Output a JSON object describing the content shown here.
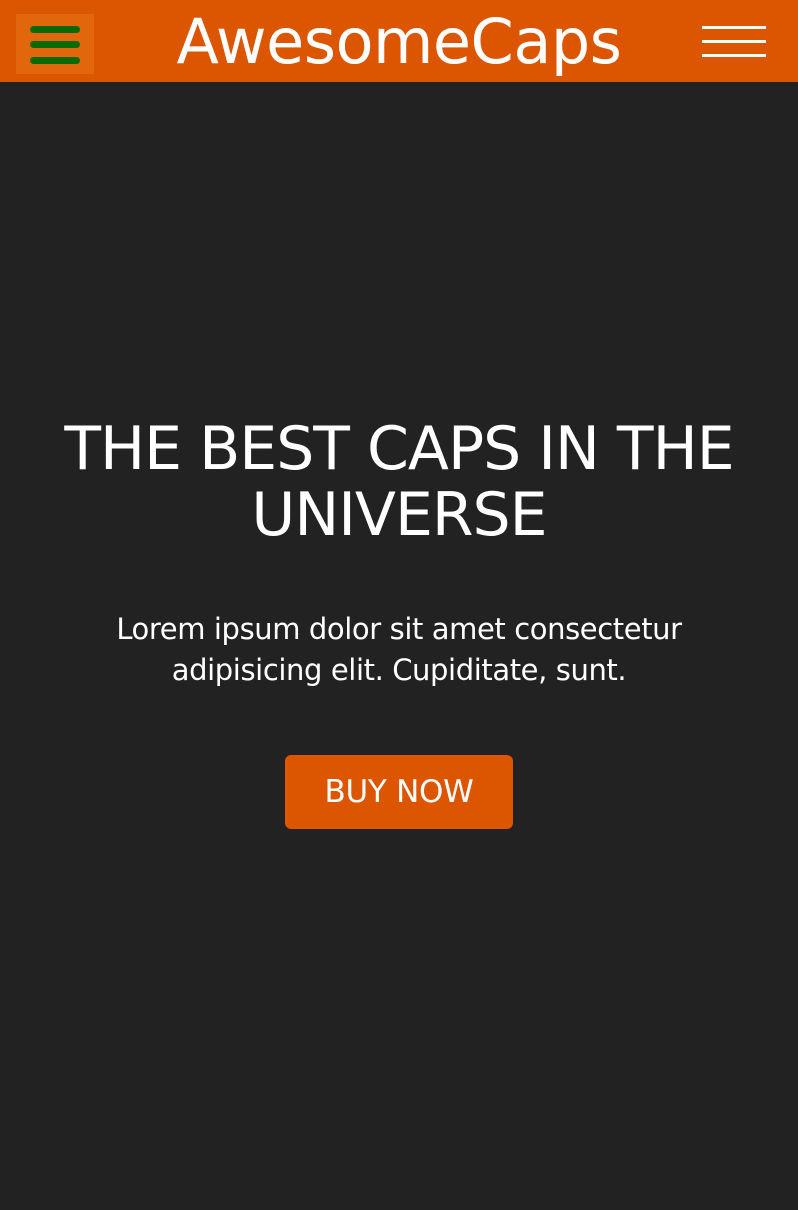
{
  "header": {
    "brand": "AwesomeCaps",
    "left_menu_icon": "hamburger-menu-icon",
    "right_menu_icon": "hamburger-menu-icon"
  },
  "hero": {
    "title": "THE BEST CAPS IN THE UNIVERSE",
    "text": "Lorem ipsum dolor sit amet consectetur adipisicing elit. Cupiditate, sunt.",
    "button_label": "BUY NOW"
  },
  "colors": {
    "header_background": "#dc5500",
    "page_background": "#222222",
    "menu_icon_bars": "#0a6a00",
    "button_background": "#dc5500",
    "text": "#ffffff"
  }
}
